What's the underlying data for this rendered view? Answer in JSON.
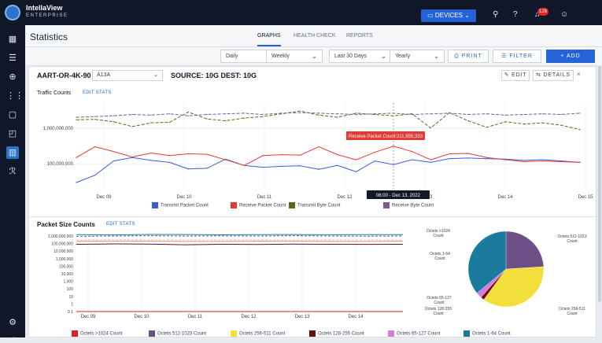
{
  "app": {
    "brand_name": "IntellaView",
    "brand_sub": "ENTERPRISE",
    "devices_label": "DEVICES",
    "notification_count": "128"
  },
  "page": {
    "title": "Statistics",
    "tabs": [
      "GRAPHS",
      "HEALTH CHECK",
      "REPORTS"
    ]
  },
  "toolbar": {
    "daily": "Daily",
    "weekly": "Weekly",
    "range": "Last 30 Days",
    "yearly": "Yearly",
    "print": "PRINT",
    "filter": "FILTER",
    "add": "ADD"
  },
  "panel": {
    "device": "AART-OR-4K-90",
    "port": "A13A",
    "source": "SOURCE: 10G DEST: 10G",
    "edit": "EDIT",
    "details": "DETAILS",
    "close": "×"
  },
  "traffic": {
    "title": "Traffic Counts",
    "edit_stats": "EDIT STATS",
    "tooltip": "Receive Packet Count:311,955,333",
    "crosshair_label": "06:00 - Dec 13, 2022"
  },
  "packet": {
    "title": "Packet Size Counts",
    "edit_stats": "EDIT STATS"
  },
  "colors": {
    "transmit_packet": "#3b5bdb",
    "receive_packet": "#e53935",
    "transmit_byte": "#5b6b15",
    "receive_byte": "#7b5a8f",
    "oct_1024": "#e01e1e",
    "oct_512": "#6e4f86",
    "oct_256": "#f2df3a",
    "oct_128": "#6b0d0d",
    "oct_65": "#d77be0",
    "oct_1_64": "#1a7b9e"
  },
  "chart_data": [
    {
      "type": "line",
      "title": "Traffic Counts",
      "y_scale": "log",
      "y_ticks": [
        "1,000,000,000",
        "100,000,000"
      ],
      "x_ticks": [
        "Dec 09",
        "Dec 10",
        "Dec 11",
        "Dec 12",
        "Dec 13",
        "Dec 14",
        "Dec 15"
      ],
      "series": [
        {
          "name": "Transmit Packet Count",
          "values": [
            30000000,
            48000000,
            120000000,
            150000000,
            125000000,
            110000000,
            72000000,
            75000000,
            135000000,
            90000000,
            80000000,
            85000000,
            88000000,
            70000000,
            90000000,
            60000000,
            120000000,
            95000000,
            130000000,
            110000000,
            140000000,
            145000000,
            140000000,
            135000000,
            125000000,
            130000000,
            120000000,
            110000000
          ]
        },
        {
          "name": "Receive Packet Count",
          "values": [
            150000000,
            300000000,
            220000000,
            155000000,
            200000000,
            170000000,
            190000000,
            185000000,
            130000000,
            90000000,
            170000000,
            180000000,
            175000000,
            300000000,
            180000000,
            130000000,
            210000000,
            311955333,
            220000000,
            130000000,
            190000000,
            195000000,
            150000000,
            130000000,
            115000000,
            120000000,
            115000000,
            110000000
          ]
        },
        {
          "name": "Transmit Byte Count",
          "values": [
            1700000000,
            1750000000,
            1500000000,
            1100000000,
            1400000000,
            1450000000,
            2800000000,
            1800000000,
            1600000000,
            1900000000,
            2100000000,
            2500000000,
            3000000000,
            2300000000,
            2000000000,
            2600000000,
            2400000000,
            2200000000,
            2500000000,
            1000000000,
            2700000000,
            1600000000,
            1050000000,
            1500000000,
            1300000000,
            1400000000,
            1200000000,
            900000000
          ]
        },
        {
          "name": "Receive Byte Count",
          "values": [
            2000000000,
            2100000000,
            2200000000,
            2400000000,
            2300000000,
            2500000000,
            2200000000,
            2400000000,
            2500000000,
            2600000000,
            2400000000,
            2600000000,
            2700000000,
            2600000000,
            2500000000,
            2400000000,
            2500000000,
            2600000000,
            2400000000,
            2500000000,
            2600000000,
            2400000000,
            2500000000,
            2300000000,
            2400000000,
            2500000000,
            2400000000,
            2600000000
          ]
        }
      ]
    },
    {
      "type": "line",
      "title": "Packet Size Counts",
      "y_scale": "log",
      "y_ticks": [
        "1,000,000,000",
        "100,000,000",
        "10,000,000",
        "1,000,000",
        "100,000",
        "10,000",
        "1,000",
        "100",
        "10",
        "1",
        "0.1"
      ],
      "x_ticks": [
        "Dec 09",
        "Dec 10",
        "Dec 11",
        "Dec 12",
        "Dec 13",
        "Dec 14"
      ],
      "series": [
        {
          "name": "Octets >1024 Count",
          "values": [
            0.1,
            0.1,
            0.1,
            0.1,
            0.1,
            0.1,
            0.1,
            0.1,
            0.1,
            0.1
          ]
        },
        {
          "name": "Octets 512-1023 Count",
          "values": [
            900000000,
            1000000000,
            1100000000,
            1000000000,
            1050000000,
            1000000000,
            1100000000,
            1000000000,
            950000000,
            1000000000
          ]
        },
        {
          "name": "Octets 256-511 Count",
          "values": [
            300000000,
            350000000,
            320000000,
            300000000,
            310000000,
            330000000,
            300000000,
            320000000,
            310000000,
            300000000
          ]
        },
        {
          "name": "Octets 128-255 Count",
          "values": [
            80000000,
            90000000,
            85000000,
            70000000,
            80000000,
            75000000,
            85000000,
            80000000,
            78000000,
            82000000
          ]
        },
        {
          "name": "Octets 65-127 Count",
          "values": [
            200000000,
            220000000,
            210000000,
            190000000,
            200000000,
            210000000,
            205000000,
            200000000,
            195000000,
            210000000
          ]
        },
        {
          "name": "Octets 1-64 Count",
          "values": [
            1500000000,
            1400000000,
            1600000000,
            1550000000,
            1450000000,
            1500000000,
            1550000000,
            1480000000,
            1520000000,
            1500000000
          ]
        }
      ]
    },
    {
      "type": "pie",
      "slices": [
        {
          "name": "Octets >1024 Count",
          "value": 0.001
        },
        {
          "name": "Octets 512-1023 Count",
          "value": 24
        },
        {
          "name": "Octets 256-511 Count",
          "value": 36
        },
        {
          "name": "Octets 128-255 Count",
          "value": 1.5
        },
        {
          "name": "Octets 65-127 Count",
          "value": 2.5
        },
        {
          "name": "Octets 1-64 Count",
          "value": 36
        }
      ],
      "labels": {
        "oct_1024": "Octets >1024 Count",
        "oct_512": "Octets 512-1023 Count",
        "oct_1_64": "Octets 1-64 Count",
        "oct_65": "Octets 65-127 Count",
        "oct_128": "Octets 128-255 Count",
        "oct_256": "Octets 256-511 Count"
      }
    }
  ]
}
